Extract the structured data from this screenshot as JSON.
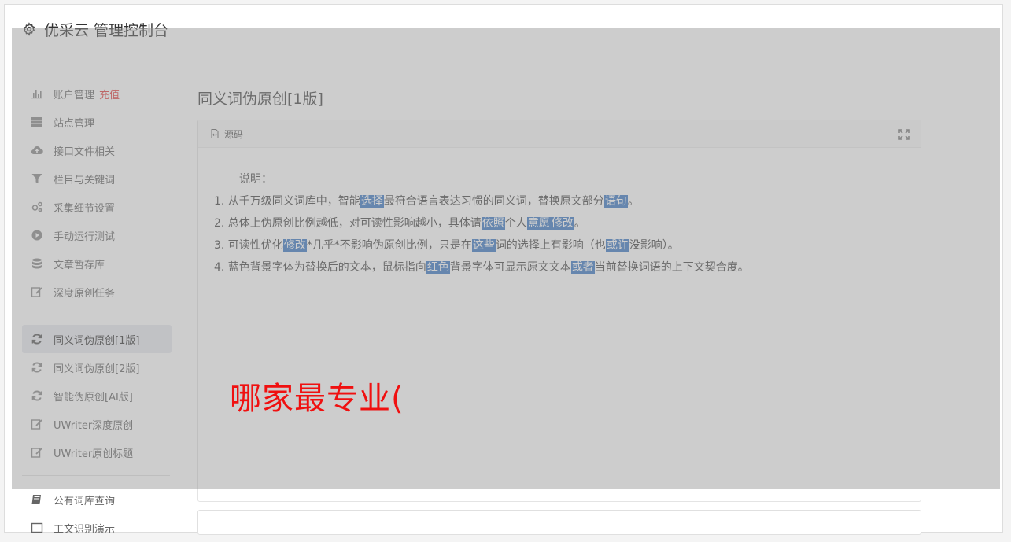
{
  "header": {
    "title": "优采云 管理控制台"
  },
  "sidebar": {
    "items": [
      {
        "label": "账户管理",
        "badge": "充值"
      },
      {
        "label": "站点管理"
      },
      {
        "label": "接口文件相关"
      },
      {
        "label": "栏目与关键词"
      },
      {
        "label": "采集细节设置"
      },
      {
        "label": "手动运行测试"
      },
      {
        "label": "文章暂存库"
      },
      {
        "label": "深度原创任务"
      }
    ],
    "items2": [
      {
        "label": "同义词伪原创[1版]",
        "active": true
      },
      {
        "label": "同义词伪原创[2版]"
      },
      {
        "label": "智能伪原创[AI版]"
      },
      {
        "label": "UWriter深度原创"
      },
      {
        "label": "UWriter原创标题"
      }
    ],
    "items3": [
      {
        "label": "公有词库查询"
      },
      {
        "label": "工文识别演示"
      }
    ]
  },
  "main": {
    "title": "同义词伪原创[1版]",
    "panel": {
      "label": "源码",
      "intro": "说明：",
      "lines": [
        [
          "1. 从千万级同义词库中，智能",
          {
            "hl": "选择"
          },
          "最符合语言表达习惯的同义词，替换原文部分",
          {
            "hl": "语句"
          },
          "。"
        ],
        [
          "2. 总体上伪原创比例越低，对可读性影响越小，具体请",
          {
            "hl": "依照"
          },
          "个人",
          {
            "hl": "意愿"
          },
          {
            "hl": "修改"
          },
          "。"
        ],
        [
          "3. 可读性优化",
          {
            "hl": "修改"
          },
          "*几乎*不影响伪原创比例，只是在",
          {
            "hl": "这些"
          },
          "词的选择上有影响（也",
          {
            "hl": "或许"
          },
          "没影响）。"
        ],
        [
          "4. 蓝色背景字体为替换后的文本，鼠标指向",
          {
            "hl": "红色"
          },
          "背景字体可显示原文文本",
          {
            "hl": "或者"
          },
          "当前替换词语的上下文契合度。"
        ]
      ]
    }
  },
  "watermark": "哪家最专业(",
  "colors": {
    "highlight": "#3a78c4",
    "watermark": "#f01010",
    "badge": "#e23b3b"
  }
}
